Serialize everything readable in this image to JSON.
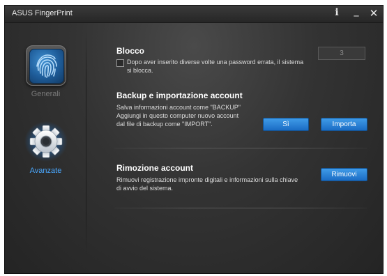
{
  "window": {
    "title": "ASUS FingerPrint"
  },
  "titlebar": {
    "info_glyph": "i",
    "minimize_glyph": "_",
    "close_glyph": "✕"
  },
  "sidebar": {
    "items": [
      {
        "label": "Generali",
        "icon": "fingerprint-icon",
        "selected": false
      },
      {
        "label": "Avanzate",
        "icon": "gear-icon",
        "selected": true
      }
    ]
  },
  "lock": {
    "title": "Blocco",
    "checkbox_label_line1": "Dopo aver inserito diverse volte una password errata, il sistema",
    "checkbox_label_line2": "si blocca.",
    "checked": false,
    "attempts_value": "3"
  },
  "backup": {
    "title": "Backup e importazione account",
    "desc_line1": "Salva informazioni account come \"BACKUP\"",
    "desc_line2": "Aggiungi in questo computer nuovo account",
    "desc_line3": "dal file di backup come \"IMPORT\".",
    "yes_label": "Sì",
    "import_label": "Importa"
  },
  "removal": {
    "title": "Rimozione account",
    "desc_line1": "Rimuovi registrazione impronte digitali e informazioni sulla chiave",
    "desc_line2": "di avvio del sistema.",
    "remove_label": "Rimuovi"
  },
  "colors": {
    "accent": "#1f78d6",
    "active_nav": "#4aa8ff",
    "background": "#333333"
  }
}
